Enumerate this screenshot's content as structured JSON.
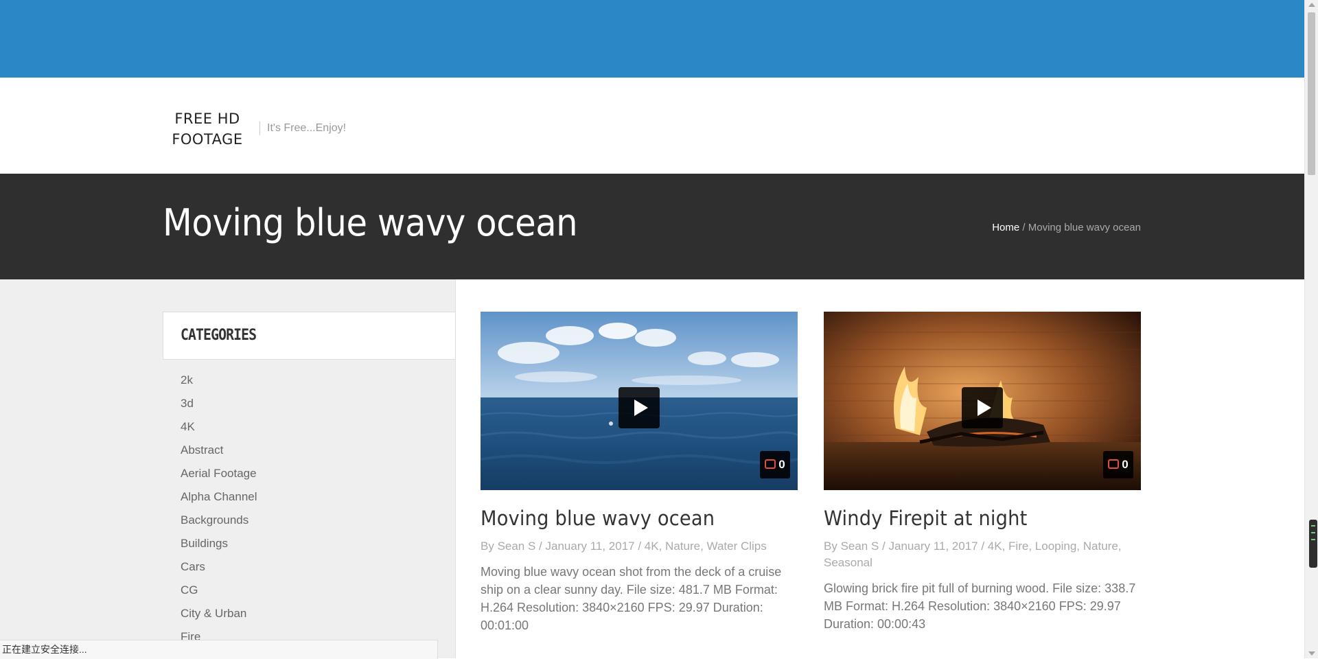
{
  "site": {
    "logo": "FREE HD FOOTAGE",
    "tagline": "It's Free...Enjoy!"
  },
  "titlebar": {
    "title": "Moving blue wavy ocean",
    "breadcrumb_home": "Home",
    "breadcrumb_sep": " / ",
    "breadcrumb_current": "Moving blue wavy ocean"
  },
  "sidebar": {
    "heading": "CATEGORIES",
    "items": [
      "2k",
      "3d",
      "4K",
      "Abstract",
      "Aerial Footage",
      "Alpha Channel",
      "Backgrounds",
      "Buildings",
      "Cars",
      "CG",
      "City & Urban",
      "Fire"
    ]
  },
  "posts": [
    {
      "title": "Moving blue wavy ocean",
      "by": "By ",
      "author": "Sean S",
      "date": "January 11, 2017",
      "categories": [
        "4K",
        "Nature",
        "Water Clips"
      ],
      "excerpt": "Moving blue wavy ocean shot from the deck of a cruise ship on a clear sunny day. File size: 481.7 MB Format: H.264 Resolution: 3840×2160 FPS: 29.97 Duration: 00:01:00",
      "comments": "0"
    },
    {
      "title": "Windy Firepit at night",
      "by": "By ",
      "author": "Sean S",
      "date": "January 11, 2017",
      "categories": [
        "4K",
        "Fire",
        "Looping",
        "Nature",
        "Seasonal"
      ],
      "excerpt": "Glowing brick fire pit full of burning wood. File size: 338.7 MB Format: H.264 Resolution: 3840×2160 FPS: 29.97 Duration: 00:00:43",
      "comments": "0"
    }
  ],
  "status": {
    "text": "正在建立安全连接..."
  },
  "colors": {
    "topbar": "#2b87c6",
    "titlebar": "#2f2f2f",
    "comment_icon": "#e74c3c"
  }
}
